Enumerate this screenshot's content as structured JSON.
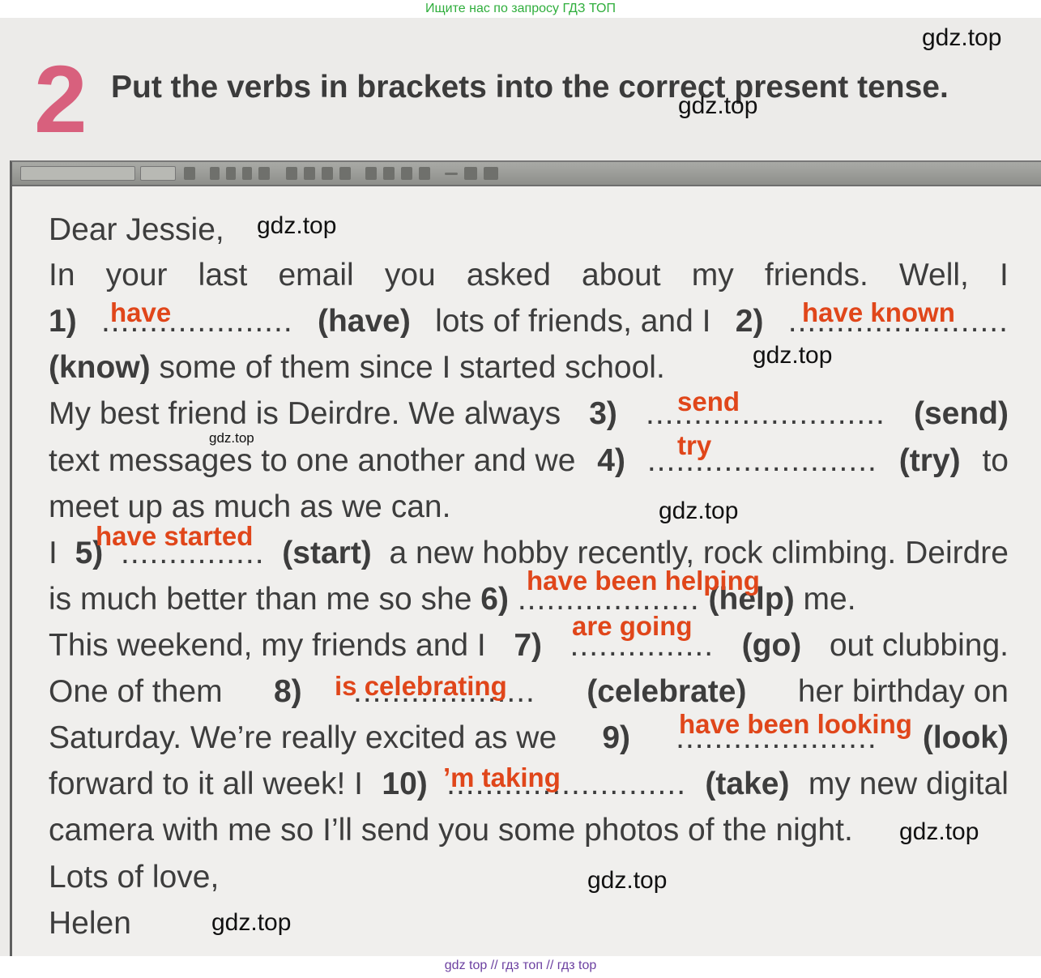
{
  "top_banner": "Ищите нас по запросу ГДЗ ТОП",
  "exercise_number": "2",
  "instruction": "Put the verbs in brackets into the correct present tense.",
  "watermark": "gdz.top",
  "letter": {
    "l1": "Dear Jessie,",
    "l2": [
      "In",
      "your",
      "last",
      "email",
      "you",
      "asked",
      "about",
      "my",
      "friends.",
      "Well,",
      "I"
    ],
    "l3": {
      "n1": "1)",
      "d1": "....................",
      "v1": "(have)",
      "t1": "lots of friends, and I",
      "n2": "2)",
      "d2": "......................."
    },
    "l4": {
      "v": "(know)",
      "t": "some of them since I started school."
    },
    "l5": {
      "t": "My best friend is Deirdre. We always",
      "n": "3)",
      "d": ".........................",
      "v": "(send)"
    },
    "l6": {
      "t": "text messages to one another and we",
      "n": "4)",
      "d": "........................",
      "v": "(try)",
      "t2": "to"
    },
    "l7": "meet up as much as we can.",
    "l8": {
      "t0": "I",
      "n": "5)",
      "d": "...............",
      "v": "(start)",
      "t": "a new hobby recently, rock climbing. Deirdre"
    },
    "l9": {
      "t": "is much better than me so she",
      "n": "6)",
      "d": "...................",
      "v": "(help)",
      "t2": "me."
    },
    "l10": {
      "t": "This weekend, my friends and I",
      "n": "7)",
      "d": "...............",
      "v": "(go)",
      "t2": "out clubbing."
    },
    "l11": {
      "t": "One of them",
      "n": "8)",
      "d": "...................",
      "v": "(celebrate)",
      "t2": "her birthday on"
    },
    "l12": {
      "t": "Saturday. We’re really excited as we",
      "n": "9)",
      "d": ".....................",
      "v": "(look)"
    },
    "l13": {
      "t": "forward to it all week! I",
      "n": "10)",
      "d": ".........................",
      "v": "(take)",
      "t2": "my new digital"
    },
    "l14": "camera with me so I’ll send you some photos of the night.",
    "l15": "Lots of love,",
    "l16": "Helen"
  },
  "answers": {
    "a1": "have",
    "a2": "have known",
    "a3": "send",
    "a4": "try",
    "a5": "have started",
    "a6": "have been helping",
    "a7": "are going",
    "a8": "is celebrating",
    "a9": "have been looking",
    "a10": "’m taking"
  },
  "bottom_bar": "gdz top  //  гдз топ  //  гдз top",
  "colors": {
    "answer": "#e0461a",
    "number": "#d8607d",
    "banner": "#2fae3c",
    "bottom": "#6b3fa0"
  }
}
